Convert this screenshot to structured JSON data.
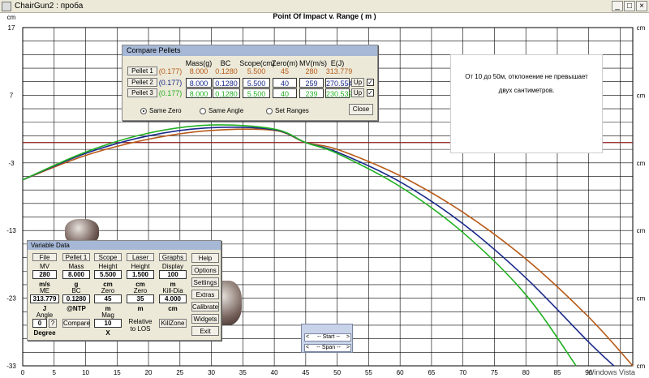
{
  "window": {
    "title": "ChairGun2 : проба",
    "controls": [
      "_",
      "□",
      "×"
    ]
  },
  "chart_data": {
    "type": "line",
    "title": "Point Of Impact v. Range ( m )",
    "ylabel": "cm",
    "xlabel": "",
    "xlim": [
      0,
      97
    ],
    "ylim": [
      -33,
      17
    ],
    "x_ticks": [
      0,
      5,
      10,
      15,
      20,
      25,
      30,
      35,
      40,
      45,
      50,
      55,
      60,
      65,
      70,
      75,
      80,
      85,
      90
    ],
    "y_ticks_left": [
      17,
      7,
      -3,
      -13,
      -23,
      -33
    ],
    "y_ticks_right_label": "cm",
    "grid": true,
    "series": [
      {
        "name": "Pellet 1",
        "color": "#b85a18",
        "x": [
          0,
          10,
          20,
          30,
          40,
          45,
          50,
          60,
          70,
          80,
          90,
          97
        ],
        "y": [
          -5.5,
          -1.9,
          0.5,
          1.8,
          1.8,
          0.0,
          -1.0,
          -4.9,
          -10.3,
          -17.2,
          -25.8,
          -33.0
        ]
      },
      {
        "name": "Pellet 2",
        "color": "#1a2a8a",
        "x": [
          0,
          10,
          20,
          30,
          40,
          45,
          50,
          60,
          70,
          80,
          90,
          94
        ],
        "y": [
          -5.5,
          -1.6,
          1.0,
          2.2,
          1.9,
          0.0,
          -1.4,
          -5.8,
          -12.0,
          -20.0,
          -29.5,
          -33.0
        ]
      },
      {
        "name": "Pellet 3",
        "color": "#22b022",
        "x": [
          0,
          10,
          20,
          30,
          40,
          45,
          50,
          60,
          70,
          80,
          88
        ],
        "y": [
          -5.5,
          -1.4,
          1.4,
          2.6,
          2.0,
          0.0,
          -1.6,
          -6.5,
          -13.3,
          -22.5,
          -33.0
        ]
      }
    ],
    "zero_line": {
      "y": 0,
      "color": "#8b1a1a"
    }
  },
  "compare": {
    "title": "Compare Pellets",
    "headers": [
      "Mass(g)",
      "BC",
      "Scope(cm)",
      "Zero(m)",
      "MV(m/s)",
      "E(J)"
    ],
    "pellets": [
      {
        "button": "Pellet 1",
        "caliber": "(0.177)",
        "mass": "8.000",
        "bc": "0.1280",
        "scope": "5.500",
        "zero": "45",
        "mv": "280",
        "energy": "313.779",
        "color": "#b85a18"
      },
      {
        "button": "Pellet 2",
        "caliber": "(0.177)",
        "mass": "8.000",
        "bc": "0.1280",
        "scope": "5.500",
        "zero": "40",
        "mv": "259",
        "energy": "270.554",
        "color": "#1a2a8a",
        "up": "Up",
        "checked": "✓"
      },
      {
        "button": "Pellet 3",
        "caliber": "(0.177)",
        "mass": "8.000",
        "bc": "0.1280",
        "scope": "5.500",
        "zero": "40",
        "mv": "239",
        "energy": "230.532",
        "color": "#22b022",
        "up": "Up",
        "checked": "✓"
      }
    ],
    "radios": [
      "Same Zero",
      "Same Angle",
      "Set Ranges"
    ],
    "close": "Close"
  },
  "note": {
    "line1": "От 10 до 50м, отклонение не превышает",
    "line2": "двух сантиметров."
  },
  "variable": {
    "title": "Variable Data",
    "file": "File",
    "mv_label": "MV",
    "mv": "280",
    "mv_unit": "m/s",
    "me_label": "ME",
    "me": "313.779",
    "me_unit": "J",
    "angle_label": "Angle",
    "angle": "0",
    "angle_q": "?",
    "angle_unit": "Degree",
    "pellet": "Pellet 1",
    "mass_label": "Mass",
    "mass": "8.000",
    "mass_unit": "g",
    "bc_label": "BC",
    "bc": "0.1280",
    "bc_ntp": "@NTP",
    "compare": "Compare",
    "scope": "Scope",
    "height_label": "Height",
    "height": "5.500",
    "height_unit": "cm",
    "zero_label": "Zero",
    "zero": "45",
    "zero_unit": "m",
    "mag_label": "Mag",
    "mag": "10",
    "mag_unit": "X",
    "laser": "Laser",
    "l_height_label": "Height",
    "l_height": "1.500",
    "l_height_unit": "cm",
    "l_zero_label": "Zero",
    "l_zero": "35",
    "l_zero_unit": "m",
    "relative": "Relative",
    "to_los": "to LOS",
    "graphs": "Graphs",
    "display_label": "Display",
    "display": "100",
    "display_unit": "m",
    "kill_label": "Kill-Dia",
    "kill": "4.000",
    "kill_unit": "cm",
    "killzone": "KillZone",
    "side": [
      "Help",
      "Options",
      "Settings",
      "Extras",
      "Calibrate",
      "Widgets",
      "Exit"
    ]
  },
  "startspan": {
    "start": "-- Start --",
    "span": "-- Span --",
    "left": "<",
    "right": ">"
  },
  "watermark": "Windows Vista"
}
